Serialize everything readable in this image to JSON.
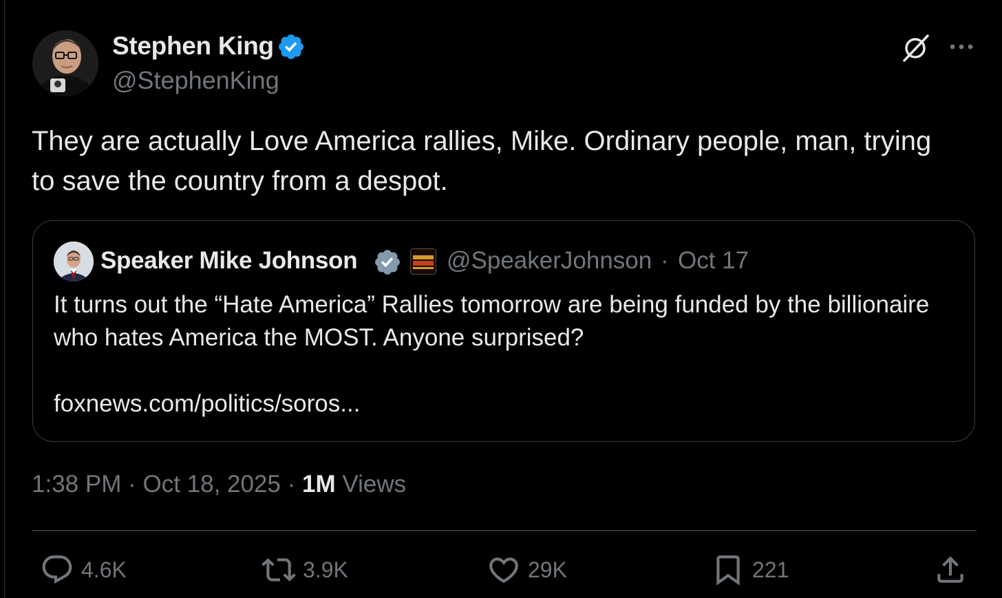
{
  "author": {
    "name": "Stephen King",
    "handle": "@StephenKing",
    "verified": true
  },
  "tweet": {
    "text": "They are actually Love America rallies, Mike. Ordinary people, man, trying to save the country from a despot."
  },
  "quote": {
    "name": "Speaker Mike Johnson",
    "handle": "@SpeakerJohnson",
    "separator": "·",
    "date": "Oct 17",
    "verified": true,
    "text": "It turns out the “Hate America” Rallies tomorrow are being funded by the billionaire who hates America the MOST. Anyone surprised?",
    "link": "foxnews.com/politics/soros..."
  },
  "meta": {
    "time": "1:38 PM",
    "sep1": "·",
    "date": "Oct 18, 2025",
    "sep2": "·",
    "views_count": "1M",
    "views_label": "Views"
  },
  "actions": {
    "replies": "4.6K",
    "reposts": "3.9K",
    "likes": "29K",
    "bookmarks": "221"
  },
  "icons": {
    "verified": "verified-badge-icon",
    "grok": "grok-icon",
    "more": "more-icon",
    "reply": "reply-icon",
    "repost": "repost-icon",
    "like": "heart-icon",
    "bookmark": "bookmark-icon",
    "share": "share-icon"
  },
  "colors": {
    "background": "#000000",
    "text_primary": "#e7e9ea",
    "text_secondary": "#71767b",
    "verified_blue": "#1d9bf0",
    "verified_gray": "#829aab",
    "border": "#2f3336"
  }
}
